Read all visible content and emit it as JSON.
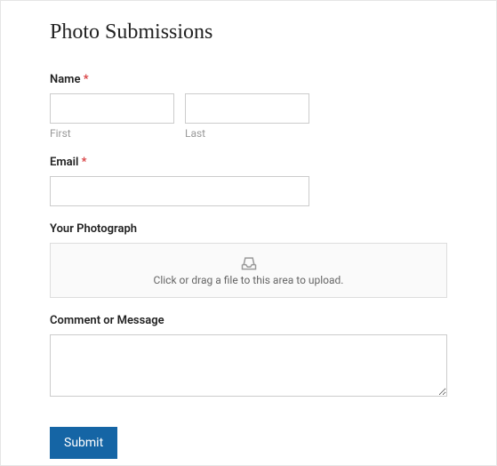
{
  "title": "Photo Submissions",
  "fields": {
    "name": {
      "label": "Name",
      "required_mark": "*",
      "first_sublabel": "First",
      "last_sublabel": "Last"
    },
    "email": {
      "label": "Email",
      "required_mark": "*"
    },
    "photograph": {
      "label": "Your Photograph",
      "upload_text": "Click or drag a file to this area to upload."
    },
    "comment": {
      "label": "Comment or Message"
    }
  },
  "submit_label": "Submit"
}
